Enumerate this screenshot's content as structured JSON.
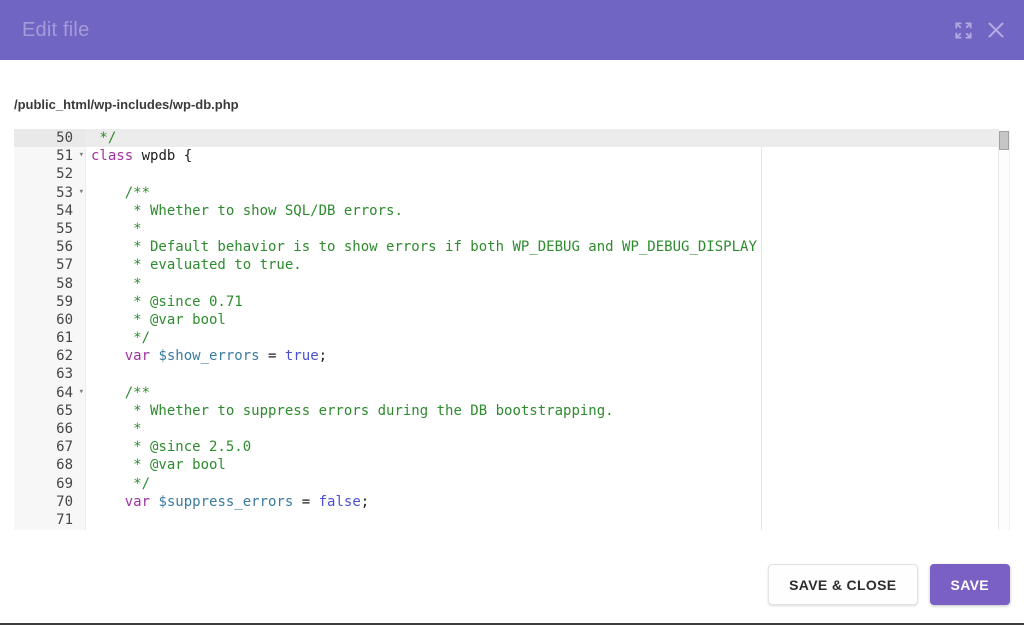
{
  "header": {
    "title": "Edit file"
  },
  "file_path": "/public_html/wp-includes/wp-db.php",
  "editor": {
    "active_line": 50,
    "fold_lines": [
      51,
      53,
      64
    ],
    "lines": [
      {
        "n": 50,
        "tokens": [
          [
            "comment",
            " */"
          ]
        ]
      },
      {
        "n": 51,
        "tokens": [
          [
            "keyword",
            "class"
          ],
          [
            "plain",
            " wpdb {"
          ]
        ]
      },
      {
        "n": 52,
        "tokens": []
      },
      {
        "n": 53,
        "tokens": [
          [
            "plain",
            "    "
          ],
          [
            "comment",
            "/**"
          ]
        ]
      },
      {
        "n": 54,
        "tokens": [
          [
            "plain",
            "    "
          ],
          [
            "comment",
            " * Whether to show SQL/DB errors."
          ]
        ]
      },
      {
        "n": 55,
        "tokens": [
          [
            "plain",
            "    "
          ],
          [
            "comment",
            " *"
          ]
        ]
      },
      {
        "n": 56,
        "tokens": [
          [
            "plain",
            "    "
          ],
          [
            "comment",
            " * Default behavior is to show errors if both WP_DEBUG and WP_DEBUG_DISPLAY"
          ]
        ]
      },
      {
        "n": 57,
        "tokens": [
          [
            "plain",
            "    "
          ],
          [
            "comment",
            " * evaluated to true."
          ]
        ]
      },
      {
        "n": 58,
        "tokens": [
          [
            "plain",
            "    "
          ],
          [
            "comment",
            " *"
          ]
        ]
      },
      {
        "n": 59,
        "tokens": [
          [
            "plain",
            "    "
          ],
          [
            "comment",
            " * @since 0.71"
          ]
        ]
      },
      {
        "n": 60,
        "tokens": [
          [
            "plain",
            "    "
          ],
          [
            "comment",
            " * @var bool"
          ]
        ]
      },
      {
        "n": 61,
        "tokens": [
          [
            "plain",
            "    "
          ],
          [
            "comment",
            " */"
          ]
        ]
      },
      {
        "n": 62,
        "tokens": [
          [
            "plain",
            "    "
          ],
          [
            "keyword",
            "var"
          ],
          [
            "plain",
            " "
          ],
          [
            "variable",
            "$show_errors"
          ],
          [
            "plain",
            " = "
          ],
          [
            "atom",
            "true"
          ],
          [
            "plain",
            ";"
          ]
        ]
      },
      {
        "n": 63,
        "tokens": []
      },
      {
        "n": 64,
        "tokens": [
          [
            "plain",
            "    "
          ],
          [
            "comment",
            "/**"
          ]
        ]
      },
      {
        "n": 65,
        "tokens": [
          [
            "plain",
            "    "
          ],
          [
            "comment",
            " * Whether to suppress errors during the DB bootstrapping."
          ]
        ]
      },
      {
        "n": 66,
        "tokens": [
          [
            "plain",
            "    "
          ],
          [
            "comment",
            " *"
          ]
        ]
      },
      {
        "n": 67,
        "tokens": [
          [
            "plain",
            "    "
          ],
          [
            "comment",
            " * @since 2.5.0"
          ]
        ]
      },
      {
        "n": 68,
        "tokens": [
          [
            "plain",
            "    "
          ],
          [
            "comment",
            " * @var bool"
          ]
        ]
      },
      {
        "n": 69,
        "tokens": [
          [
            "plain",
            "    "
          ],
          [
            "comment",
            " */"
          ]
        ]
      },
      {
        "n": 70,
        "tokens": [
          [
            "plain",
            "    "
          ],
          [
            "keyword",
            "var"
          ],
          [
            "plain",
            " "
          ],
          [
            "variable",
            "$suppress_errors"
          ],
          [
            "plain",
            " = "
          ],
          [
            "atom",
            "false"
          ],
          [
            "plain",
            ";"
          ]
        ]
      },
      {
        "n": 71,
        "tokens": []
      }
    ]
  },
  "footer": {
    "save_close_label": "SAVE & CLOSE",
    "save_label": "SAVE"
  },
  "colors": {
    "header_bg": "#7165c3",
    "header_text": "#a49bda",
    "header_icon": "#b3aae3",
    "accent_button": "#7a5fc5",
    "comment": "#2e8b2e",
    "keyword": "#a032a0",
    "variable": "#3a7a9d",
    "atom": "#4a50d0",
    "code_text": "#1b1b1b",
    "active_line_bg": "#ececec",
    "gutter_bg": "#f7f7f7",
    "line_number": "#464646"
  }
}
